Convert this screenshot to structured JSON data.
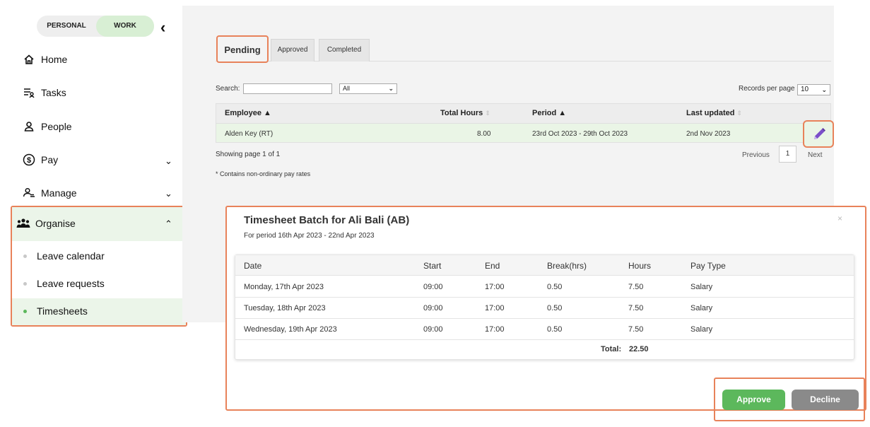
{
  "sidebar": {
    "toggle": {
      "personal": "PERSONAL",
      "work": "WORK"
    },
    "items": [
      {
        "label": "Home",
        "icon": "home-icon"
      },
      {
        "label": "Tasks",
        "icon": "tasks-icon"
      },
      {
        "label": "People",
        "icon": "person-icon"
      },
      {
        "label": "Pay",
        "icon": "dollar-icon"
      },
      {
        "label": "Manage",
        "icon": "manage-icon"
      }
    ],
    "organise": {
      "label": "Organise",
      "icon": "group-icon",
      "subitems": [
        {
          "label": "Leave calendar",
          "active": false
        },
        {
          "label": "Leave requests",
          "active": false
        },
        {
          "label": "Timesheets",
          "active": true
        }
      ]
    }
  },
  "main": {
    "tabs": [
      "Pending",
      "Approved",
      "Completed"
    ],
    "active_tab": "Pending",
    "search_label": "Search:",
    "filter_value": "All",
    "records_label": "Records per page",
    "records_value": "10",
    "columns": [
      "Employee",
      "Total Hours",
      "Period",
      "Last updated"
    ],
    "rows": [
      {
        "employee": "Alden Key (RT)",
        "hours": "8.00",
        "period": "23rd Oct 2023 - 29th Oct 2023",
        "updated": "2nd Nov 2023"
      }
    ],
    "showing": "Showing page 1 of 1",
    "note": "* Contains non-ordinary pay rates",
    "pager": {
      "previous": "Previous",
      "page": "1",
      "next": "Next"
    }
  },
  "modal": {
    "title": "Timesheet Batch for Ali Bali (AB)",
    "subtitle": "For period 16th Apr 2023 - 22nd Apr 2023",
    "close": "×",
    "columns": [
      "Date",
      "Start",
      "End",
      "Break(hrs)",
      "Hours",
      "Pay Type"
    ],
    "rows": [
      {
        "date": "Monday, 17th Apr 2023",
        "start": "09:00",
        "end": "17:00",
        "break": "0.50",
        "hours": "7.50",
        "pay_type": "Salary"
      },
      {
        "date": "Tuesday, 18th Apr 2023",
        "start": "09:00",
        "end": "17:00",
        "break": "0.50",
        "hours": "7.50",
        "pay_type": "Salary"
      },
      {
        "date": "Wednesday, 19th Apr 2023",
        "start": "09:00",
        "end": "17:00",
        "break": "0.50",
        "hours": "7.50",
        "pay_type": "Salary"
      }
    ],
    "total_label": "Total:",
    "total_value": "22.50",
    "approve": "Approve",
    "decline": "Decline"
  },
  "colors": {
    "accent_highlight": "#e8825a",
    "active_green": "#ebf5e9",
    "approve_green": "#5cb85c",
    "decline_gray": "#8a8a8a",
    "edit_purple": "#7b4fc9"
  }
}
